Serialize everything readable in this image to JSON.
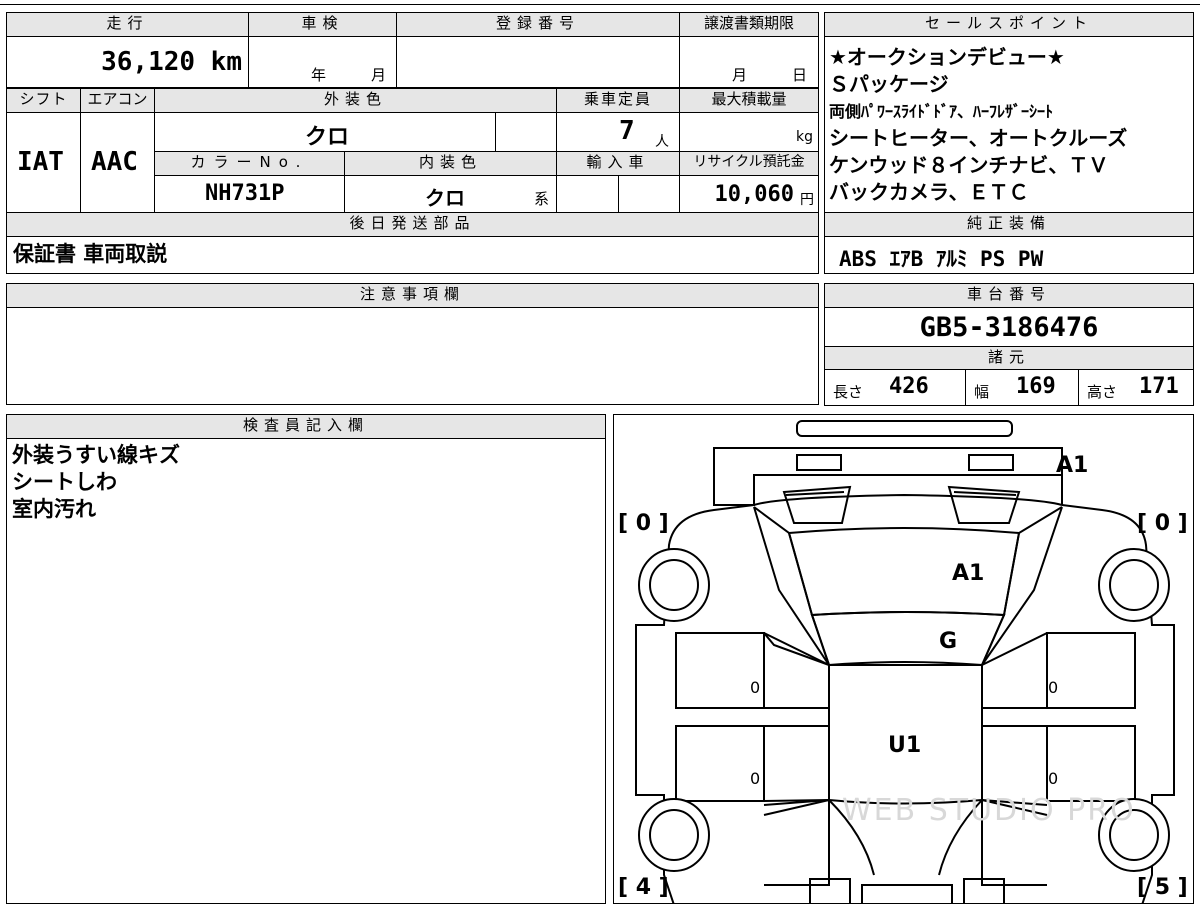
{
  "top_table": {
    "mileage_label": "走行",
    "mileage_value": "36,120 km",
    "inspection_label": "車検",
    "inspection_year_unit": "年",
    "inspection_month_unit": "月",
    "registration_label": "登録番号",
    "transfer_deadline_label": "譲渡書類期限",
    "transfer_month_unit": "月",
    "transfer_day_unit": "日",
    "shift_label": "シフト",
    "shift_value": "IAT",
    "aircon_label": "エアコン",
    "aircon_value": "AAC",
    "exterior_color_label": "外装色",
    "exterior_color_value": "クロ",
    "capacity_label": "乗車定員",
    "capacity_value": "7",
    "capacity_unit": "人",
    "max_load_label": "最大積載量",
    "max_load_unit": "kg",
    "color_no_label": "カラーNo.",
    "color_no_value": "NH731P",
    "interior_color_label": "内装色",
    "interior_color_value": "クロ",
    "interior_color_suffix": "系",
    "import_label": "輸入車",
    "recycle_label": "リサイクル預託金",
    "recycle_value": "10,060",
    "recycle_unit": "円",
    "later_parts_label": "後日発送部品",
    "later_parts_value": "保証書 車両取説"
  },
  "sales_points": {
    "label": "セールスポイント",
    "lines": [
      "★オークションデビュー★",
      "Ｓパッケージ",
      "両側ﾊﾟﾜｰｽﾗｲﾄﾞﾄﾞｱ、ﾊｰﾌﾚｻﾞｰｼｰﾄ",
      "シートヒーター、オートクルーズ",
      "ケンウッド８インチナビ、ＴＶ",
      "バックカメラ、ＥＴＣ"
    ]
  },
  "genuine_equipment": {
    "label": "純正装備",
    "value": "ABS ｴｱB ｱﾙﾐ PS PW"
  },
  "caution": {
    "label": "注意事項欄",
    "value": ""
  },
  "chassis": {
    "label": "車台番号",
    "value": "GB5-3186476"
  },
  "specs": {
    "label": "諸元",
    "length_label": "長さ",
    "length_value": "426",
    "width_label": "幅",
    "width_value": "169",
    "height_label": "高さ",
    "height_value": "171"
  },
  "inspector": {
    "label": "検査員記入欄",
    "lines": [
      "外装うすい線キズ",
      "シートしわ",
      "室内汚れ"
    ]
  },
  "diagram": {
    "marks": {
      "rear": "A1",
      "roof": "A1",
      "glass": "G",
      "interior": "U1",
      "left_door_front": "0",
      "left_door_rear": "0",
      "right_door_front": "0",
      "right_door_rear": "0"
    },
    "tires": {
      "front_left": "[ 0 ]",
      "front_right": "[ 0 ]",
      "rear_left": "[ 4 ]",
      "rear_right": "[ 5 ]"
    },
    "watermark": "WEB STUDIO PRO"
  }
}
